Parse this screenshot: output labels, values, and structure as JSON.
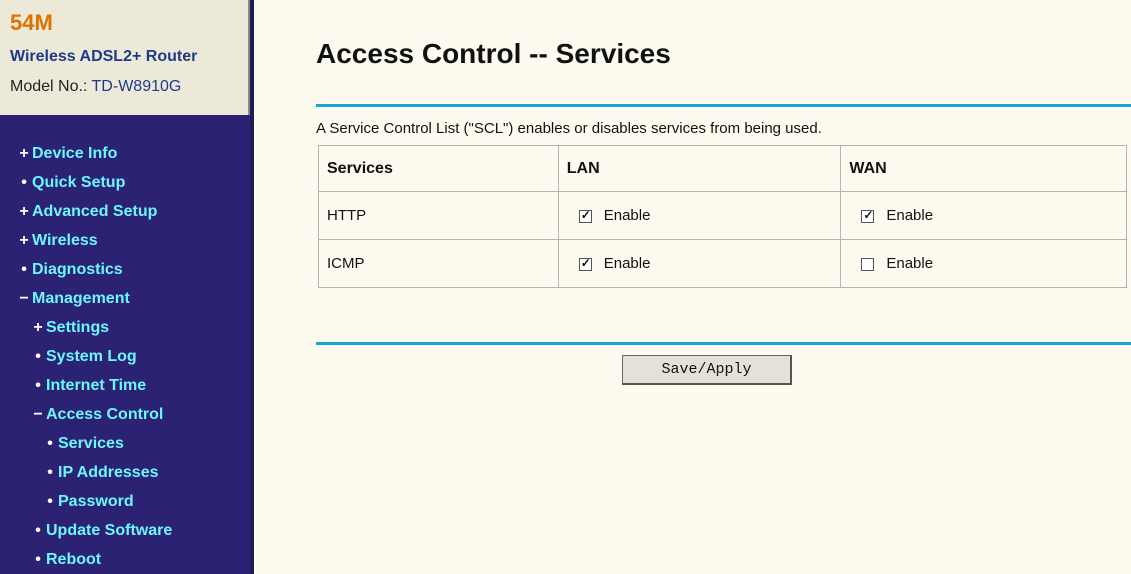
{
  "brand": {
    "speed": "54M",
    "product": "Wireless ADSL2+ Router",
    "model_label": "Model No.:",
    "model_number": "TD-W8910G"
  },
  "nav": [
    {
      "marker": "+",
      "label": "Device Info",
      "level": 0
    },
    {
      "marker": "•",
      "label": "Quick Setup",
      "level": 0
    },
    {
      "marker": "+",
      "label": "Advanced Setup",
      "level": 0
    },
    {
      "marker": "+",
      "label": "Wireless",
      "level": 0
    },
    {
      "marker": "•",
      "label": "Diagnostics",
      "level": 0
    },
    {
      "marker": "−",
      "label": "Management",
      "level": 0
    },
    {
      "marker": "+",
      "label": "Settings",
      "level": 1
    },
    {
      "marker": "•",
      "label": "System Log",
      "level": 1
    },
    {
      "marker": "•",
      "label": "Internet Time",
      "level": 1
    },
    {
      "marker": "−",
      "label": "Access Control",
      "level": 1
    },
    {
      "marker": "•",
      "label": "Services",
      "level": 2
    },
    {
      "marker": "•",
      "label": "IP Addresses",
      "level": 2
    },
    {
      "marker": "•",
      "label": "Password",
      "level": 2
    },
    {
      "marker": "•",
      "label": "Update Software",
      "level": 1
    },
    {
      "marker": "•",
      "label": "Reboot",
      "level": 1
    }
  ],
  "page": {
    "title": "Access Control -- Services",
    "description": "A Service Control List (\"SCL\") enables or disables services from being used."
  },
  "table": {
    "headers": [
      "Services",
      "LAN",
      "WAN"
    ],
    "rows": [
      {
        "service": "HTTP",
        "lan": {
          "checked": true,
          "label": "Enable"
        },
        "wan": {
          "checked": true,
          "label": "Enable"
        }
      },
      {
        "service": "ICMP",
        "lan": {
          "checked": true,
          "label": "Enable"
        },
        "wan": {
          "checked": false,
          "label": "Enable"
        }
      }
    ]
  },
  "actions": {
    "save_label": "Save/Apply"
  }
}
